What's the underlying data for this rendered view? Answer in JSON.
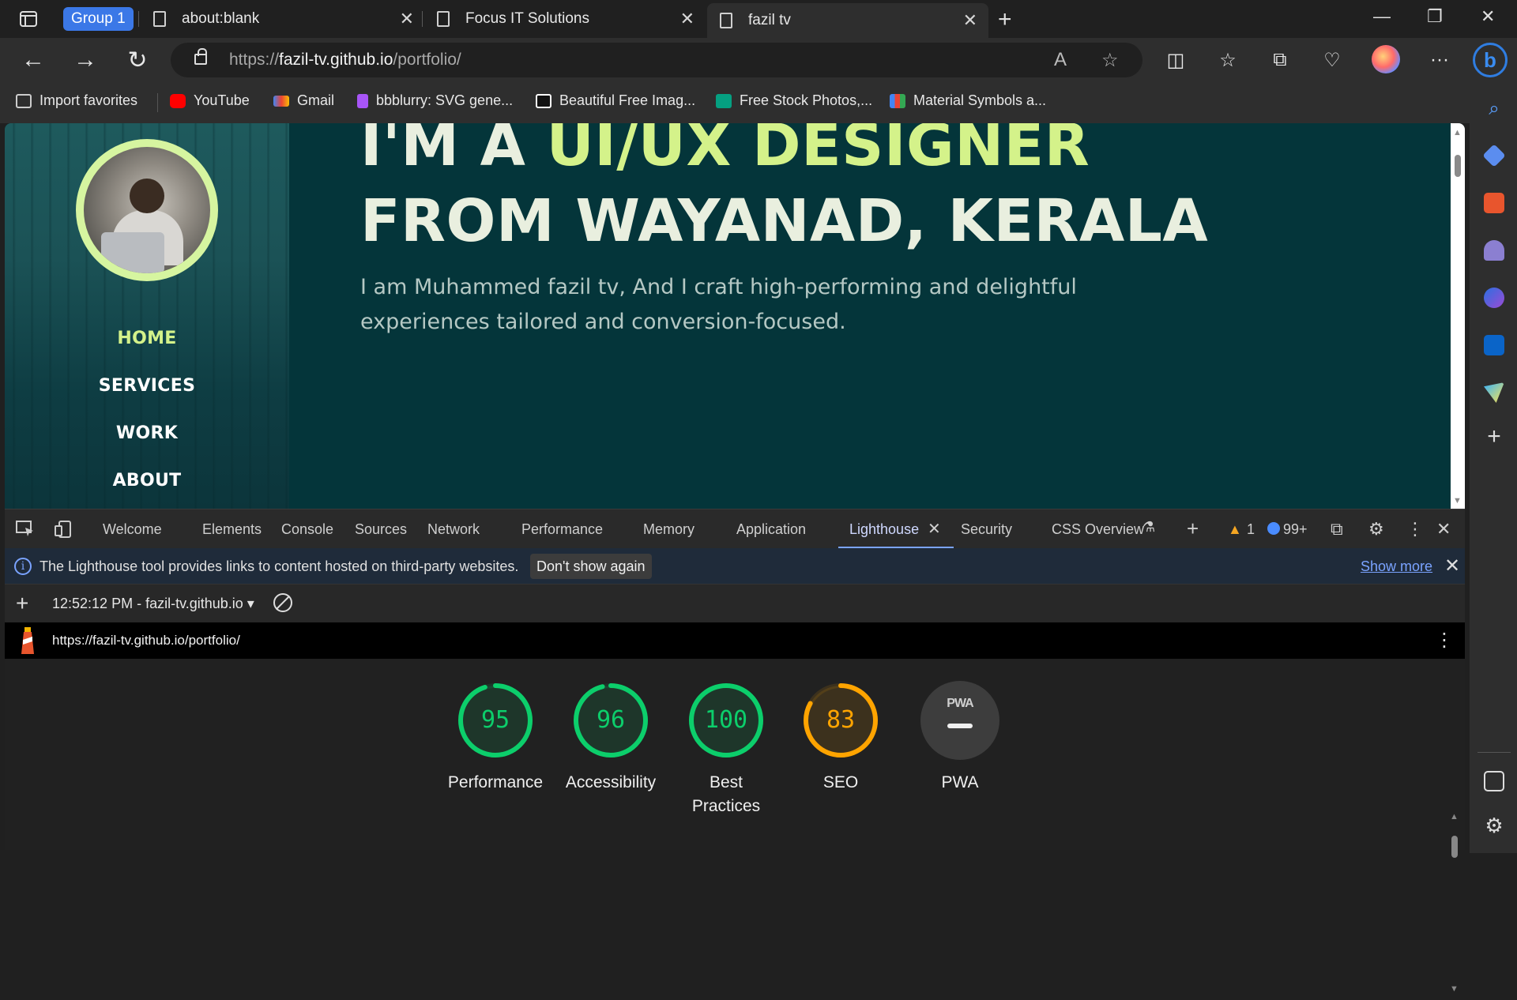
{
  "browser": {
    "group_label": "Group 1",
    "tabs": [
      {
        "title": "about:blank"
      },
      {
        "title": "Focus IT Solutions"
      },
      {
        "title": "fazil tv"
      }
    ],
    "url_prefix": "https://",
    "url_host": "fazil-tv.github.io",
    "url_path": "/portfolio/",
    "favorites": [
      {
        "label": "Import favorites",
        "icon": "import-icon",
        "color": "#cccccc"
      },
      {
        "label": "YouTube",
        "icon": "youtube-icon",
        "color": "#ff0000"
      },
      {
        "label": "Gmail",
        "icon": "gmail-icon",
        "color": "#ea4335"
      },
      {
        "label": "bbblurry: SVG gene...",
        "icon": "bbblurry-icon",
        "color": "#a855f7"
      },
      {
        "label": "Beautiful Free Imag...",
        "icon": "unsplash-icon",
        "color": "#ffffff"
      },
      {
        "label": "Free Stock Photos,...",
        "icon": "pexels-icon",
        "color": "#05a081"
      },
      {
        "label": "Material Symbols a...",
        "icon": "google-fonts-icon",
        "color": "#4285f4"
      }
    ]
  },
  "site": {
    "nav": [
      "HOME",
      "SERVICES",
      "WORK",
      "ABOUT"
    ],
    "hero_line1_prefix": "I'M A ",
    "hero_line1_highlight": "UI/UX DESIGNER",
    "hero_line2": "FROM WAYANAD, KERALA",
    "subtitle": "I am Muhammed fazil tv, And I craft high-performing and delightful experiences tailored and conversion-focused.",
    "accent_color": "#d4f28a"
  },
  "devtools": {
    "tabs": [
      "Welcome",
      "Elements",
      "Console",
      "Sources",
      "Network",
      "Performance",
      "Memory",
      "Application",
      "Lighthouse",
      "Security",
      "CSS Overview"
    ],
    "active_tab": "Lighthouse",
    "warning_count": "1",
    "message_count": "99+",
    "info_text": "The Lighthouse tool provides links to content hosted on third-party websites.",
    "dont_show_label": "Don't show again",
    "show_more_label": "Show more",
    "report_select": "12:52:12 PM - fazil-tv.github.io",
    "report_url": "https://fazil-tv.github.io/portfolio/"
  },
  "lighthouse": {
    "scores": [
      {
        "label": "Performance",
        "value": 95,
        "color": "#0cce6b"
      },
      {
        "label": "Accessibility",
        "value": 96,
        "color": "#0cce6b"
      },
      {
        "label": "Best Practices",
        "value": 100,
        "color": "#0cce6b"
      },
      {
        "label": "SEO",
        "value": 83,
        "color": "#ffa400"
      }
    ],
    "pwa_label": "PWA",
    "pwa_badge": "PWA"
  }
}
